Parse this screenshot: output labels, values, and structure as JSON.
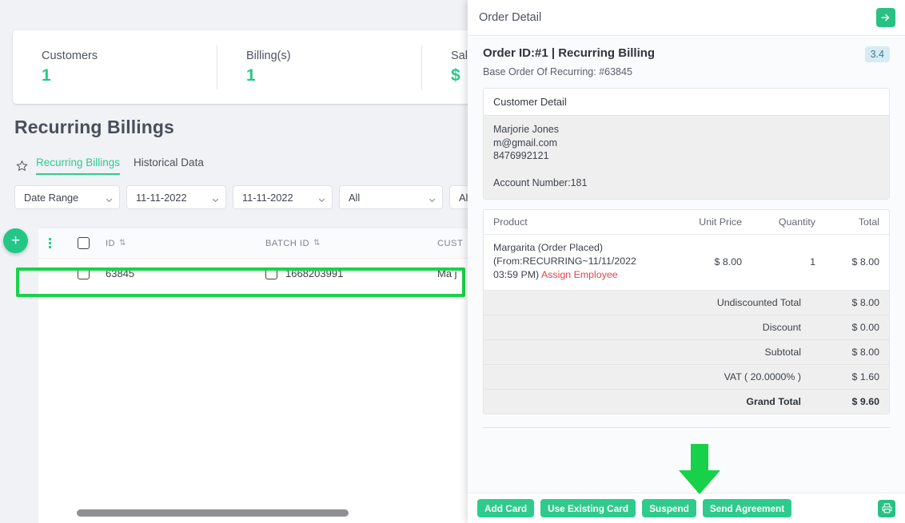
{
  "background_page": {
    "stats": [
      {
        "label": "Customers",
        "value": "1"
      },
      {
        "label": "Billing(s)",
        "value": "1"
      },
      {
        "label": "Sales",
        "value": "$"
      }
    ],
    "page_title": "Recurring Billings",
    "tabs": [
      {
        "label": "Recurring Billings",
        "active": true
      },
      {
        "label": "Historical Data",
        "active": false
      }
    ],
    "filters": [
      {
        "name": "date-range",
        "value": "Date Range"
      },
      {
        "name": "start-date",
        "value": "11-11-2022"
      },
      {
        "name": "end-date",
        "value": "11-11-2022"
      },
      {
        "name": "filter-all-1",
        "value": "All"
      },
      {
        "name": "filter-all-2",
        "value": "All"
      }
    ],
    "table": {
      "columns": [
        "ID",
        "BATCH ID",
        "CUST"
      ],
      "rows": [
        {
          "id": "63845",
          "batch_id": "1668203991",
          "customer": "Ma j"
        }
      ]
    },
    "add_button_label": "+"
  },
  "panel": {
    "header_title": "Order Detail",
    "expand_icon": "arrow-right-icon",
    "order_title": "Order ID:#1 | Recurring Billing",
    "order_badge": "3.4",
    "order_subtitle": "Base Order Of Recurring: #63845",
    "customer": {
      "section_title": "Customer Detail",
      "name": "Marjorie Jones",
      "email": "m@gmail.com",
      "phone": "8476992121",
      "account_number": "Account Number:181"
    },
    "products": {
      "columns": {
        "product": "Product",
        "unit_price": "Unit Price",
        "quantity": "Quantity",
        "total": "Total"
      },
      "rows": [
        {
          "name": "Margarita (Order Placed) (From:RECURRING~11/11/2022 03:59 PM)",
          "action_link": "Assign Employee",
          "unit_price": "$ 8.00",
          "quantity": "1",
          "total": "$ 8.00"
        }
      ],
      "summary": [
        {
          "label": "Undiscounted Total",
          "value": "$ 8.00"
        },
        {
          "label": "Discount",
          "value": "$ 0.00"
        },
        {
          "label": "Subtotal",
          "value": "$ 8.00"
        },
        {
          "label": "VAT ( 20.0000% )",
          "value": "$ 1.60"
        },
        {
          "label": "Grand Total",
          "value": "$ 9.60"
        }
      ]
    },
    "footer": {
      "buttons": [
        "Add Card",
        "Use Existing Card",
        "Suspend",
        "Send Agreement"
      ],
      "print_icon": "printer-icon"
    }
  },
  "colors": {
    "accent_green": "#2ecb8d",
    "annotation_green": "#19d24a",
    "badge_blue_bg": "#d6ecf5",
    "badge_blue_text": "#41788f",
    "link_red": "#e8424a",
    "page_bg": "#f1f2f5"
  }
}
